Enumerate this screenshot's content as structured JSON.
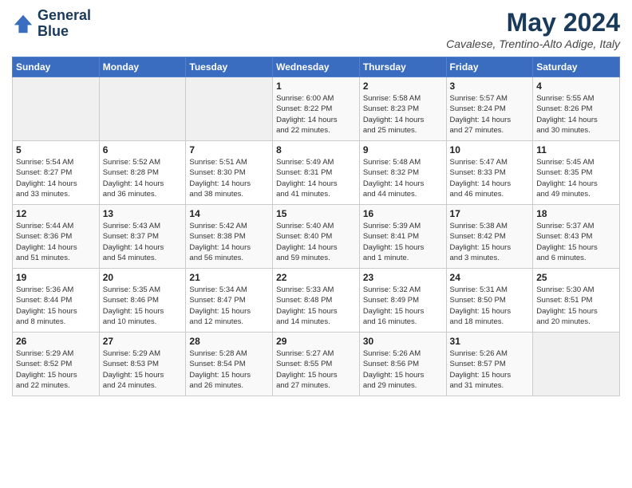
{
  "logo": {
    "line1": "General",
    "line2": "Blue"
  },
  "title": "May 2024",
  "location": "Cavalese, Trentino-Alto Adige, Italy",
  "days_of_week": [
    "Sunday",
    "Monday",
    "Tuesday",
    "Wednesday",
    "Thursday",
    "Friday",
    "Saturday"
  ],
  "weeks": [
    [
      {
        "day": "",
        "info": ""
      },
      {
        "day": "",
        "info": ""
      },
      {
        "day": "",
        "info": ""
      },
      {
        "day": "1",
        "info": "Sunrise: 6:00 AM\nSunset: 8:22 PM\nDaylight: 14 hours\nand 22 minutes."
      },
      {
        "day": "2",
        "info": "Sunrise: 5:58 AM\nSunset: 8:23 PM\nDaylight: 14 hours\nand 25 minutes."
      },
      {
        "day": "3",
        "info": "Sunrise: 5:57 AM\nSunset: 8:24 PM\nDaylight: 14 hours\nand 27 minutes."
      },
      {
        "day": "4",
        "info": "Sunrise: 5:55 AM\nSunset: 8:26 PM\nDaylight: 14 hours\nand 30 minutes."
      }
    ],
    [
      {
        "day": "5",
        "info": "Sunrise: 5:54 AM\nSunset: 8:27 PM\nDaylight: 14 hours\nand 33 minutes."
      },
      {
        "day": "6",
        "info": "Sunrise: 5:52 AM\nSunset: 8:28 PM\nDaylight: 14 hours\nand 36 minutes."
      },
      {
        "day": "7",
        "info": "Sunrise: 5:51 AM\nSunset: 8:30 PM\nDaylight: 14 hours\nand 38 minutes."
      },
      {
        "day": "8",
        "info": "Sunrise: 5:49 AM\nSunset: 8:31 PM\nDaylight: 14 hours\nand 41 minutes."
      },
      {
        "day": "9",
        "info": "Sunrise: 5:48 AM\nSunset: 8:32 PM\nDaylight: 14 hours\nand 44 minutes."
      },
      {
        "day": "10",
        "info": "Sunrise: 5:47 AM\nSunset: 8:33 PM\nDaylight: 14 hours\nand 46 minutes."
      },
      {
        "day": "11",
        "info": "Sunrise: 5:45 AM\nSunset: 8:35 PM\nDaylight: 14 hours\nand 49 minutes."
      }
    ],
    [
      {
        "day": "12",
        "info": "Sunrise: 5:44 AM\nSunset: 8:36 PM\nDaylight: 14 hours\nand 51 minutes."
      },
      {
        "day": "13",
        "info": "Sunrise: 5:43 AM\nSunset: 8:37 PM\nDaylight: 14 hours\nand 54 minutes."
      },
      {
        "day": "14",
        "info": "Sunrise: 5:42 AM\nSunset: 8:38 PM\nDaylight: 14 hours\nand 56 minutes."
      },
      {
        "day": "15",
        "info": "Sunrise: 5:40 AM\nSunset: 8:40 PM\nDaylight: 14 hours\nand 59 minutes."
      },
      {
        "day": "16",
        "info": "Sunrise: 5:39 AM\nSunset: 8:41 PM\nDaylight: 15 hours\nand 1 minute."
      },
      {
        "day": "17",
        "info": "Sunrise: 5:38 AM\nSunset: 8:42 PM\nDaylight: 15 hours\nand 3 minutes."
      },
      {
        "day": "18",
        "info": "Sunrise: 5:37 AM\nSunset: 8:43 PM\nDaylight: 15 hours\nand 6 minutes."
      }
    ],
    [
      {
        "day": "19",
        "info": "Sunrise: 5:36 AM\nSunset: 8:44 PM\nDaylight: 15 hours\nand 8 minutes."
      },
      {
        "day": "20",
        "info": "Sunrise: 5:35 AM\nSunset: 8:46 PM\nDaylight: 15 hours\nand 10 minutes."
      },
      {
        "day": "21",
        "info": "Sunrise: 5:34 AM\nSunset: 8:47 PM\nDaylight: 15 hours\nand 12 minutes."
      },
      {
        "day": "22",
        "info": "Sunrise: 5:33 AM\nSunset: 8:48 PM\nDaylight: 15 hours\nand 14 minutes."
      },
      {
        "day": "23",
        "info": "Sunrise: 5:32 AM\nSunset: 8:49 PM\nDaylight: 15 hours\nand 16 minutes."
      },
      {
        "day": "24",
        "info": "Sunrise: 5:31 AM\nSunset: 8:50 PM\nDaylight: 15 hours\nand 18 minutes."
      },
      {
        "day": "25",
        "info": "Sunrise: 5:30 AM\nSunset: 8:51 PM\nDaylight: 15 hours\nand 20 minutes."
      }
    ],
    [
      {
        "day": "26",
        "info": "Sunrise: 5:29 AM\nSunset: 8:52 PM\nDaylight: 15 hours\nand 22 minutes."
      },
      {
        "day": "27",
        "info": "Sunrise: 5:29 AM\nSunset: 8:53 PM\nDaylight: 15 hours\nand 24 minutes."
      },
      {
        "day": "28",
        "info": "Sunrise: 5:28 AM\nSunset: 8:54 PM\nDaylight: 15 hours\nand 26 minutes."
      },
      {
        "day": "29",
        "info": "Sunrise: 5:27 AM\nSunset: 8:55 PM\nDaylight: 15 hours\nand 27 minutes."
      },
      {
        "day": "30",
        "info": "Sunrise: 5:26 AM\nSunset: 8:56 PM\nDaylight: 15 hours\nand 29 minutes."
      },
      {
        "day": "31",
        "info": "Sunrise: 5:26 AM\nSunset: 8:57 PM\nDaylight: 15 hours\nand 31 minutes."
      },
      {
        "day": "",
        "info": ""
      }
    ]
  ]
}
